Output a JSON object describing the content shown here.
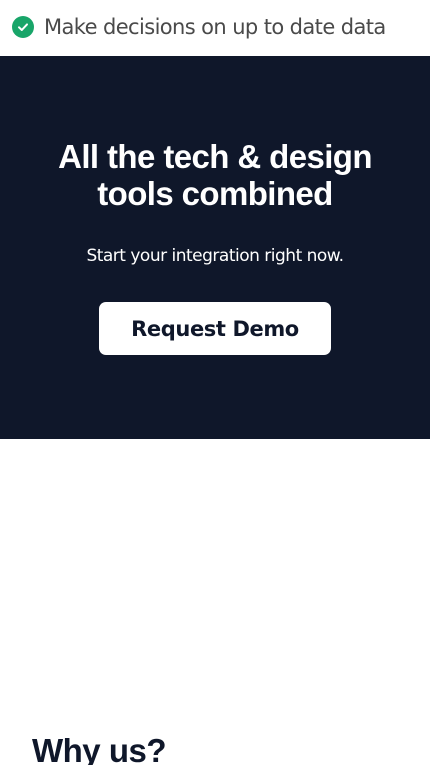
{
  "feature_strip": {
    "icon": "check-circle-icon",
    "text": "Make decisions on up to date data"
  },
  "hero": {
    "title": "All the tech & design tools combined",
    "subtitle": "Start your integration right now.",
    "cta_label": "Request Demo"
  },
  "why_section": {
    "heading": "Why us?"
  },
  "colors": {
    "hero_background": "#0f172a",
    "check_green": "#18a569",
    "heading_dark": "#0f172a"
  }
}
